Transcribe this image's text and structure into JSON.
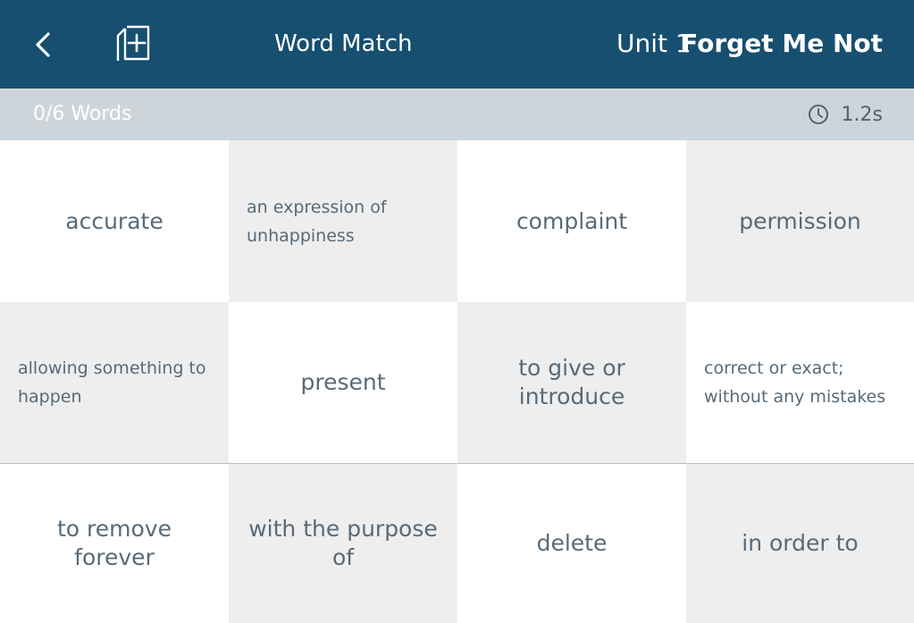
{
  "header": {
    "title": "Word Match",
    "unit": "Unit 1",
    "deck_name": "Forget Me Not",
    "background_color": "#174f70"
  },
  "status": {
    "words_progress": "0/6 Words",
    "timer": "1.2s",
    "background_color": "#ced5da"
  },
  "tiles": [
    {
      "text": "accurate"
    },
    {
      "text": "an expression of unhappiness"
    },
    {
      "text": "complaint"
    },
    {
      "text": "permission"
    },
    {
      "text": "allowing something to happen"
    },
    {
      "text": "present"
    },
    {
      "text": "to give or introduce"
    },
    {
      "text": "correct or exact; without any mistakes"
    },
    {
      "text": "to remove forever"
    },
    {
      "text": "with the purpose of"
    },
    {
      "text": "delete"
    },
    {
      "text": "in order to"
    }
  ],
  "icons": {
    "back": "chevron-left-icon",
    "add": "add-card-icon",
    "timer": "clock-icon"
  }
}
